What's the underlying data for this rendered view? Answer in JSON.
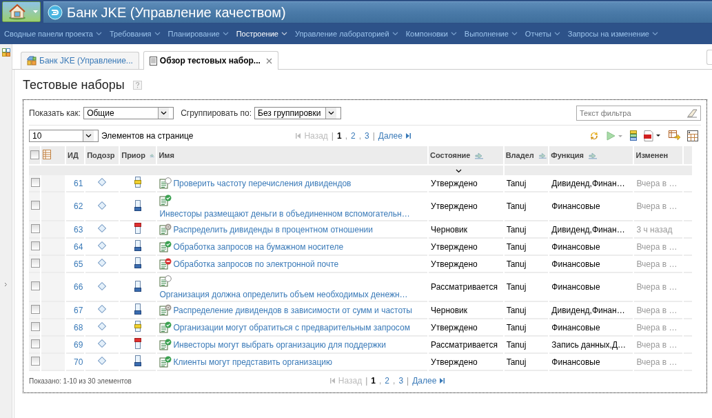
{
  "app_title": "Банк JKE (Управление качеством)",
  "nav": [
    {
      "label": "Сводные панели проекта",
      "selected": false
    },
    {
      "label": "Требования",
      "selected": false
    },
    {
      "label": "Планирование",
      "selected": false
    },
    {
      "label": "Построение",
      "selected": true
    },
    {
      "label": "Управление лабораторией",
      "selected": false
    },
    {
      "label": "Компоновки",
      "selected": false
    },
    {
      "label": "Выполнение",
      "selected": false
    },
    {
      "label": "Отчеты",
      "selected": false
    },
    {
      "label": "Запросы на изменение",
      "selected": false
    }
  ],
  "tabs": [
    {
      "label": "Банк JKE (Управление...",
      "selected": false,
      "closable": false
    },
    {
      "label": "Обзор тестовых набор...",
      "selected": true,
      "closable": true
    }
  ],
  "page_title": "Тестовые наборы",
  "show_as": {
    "label": "Показать как:",
    "value": "Общие"
  },
  "group_by": {
    "label": "Сгруппировать по:",
    "value": "Без группировки"
  },
  "filter": {
    "placeholder": "Текст фильтра"
  },
  "page_size": {
    "value": "10",
    "label": "Элементов на странице"
  },
  "pager_top": [
    {
      "kind": "prev",
      "text": "Назад",
      "disabled": true
    },
    {
      "kind": "sep",
      "text": "|"
    },
    {
      "kind": "page",
      "text": "1",
      "selected": true
    },
    {
      "kind": "sep",
      "text": ","
    },
    {
      "kind": "page",
      "text": "2",
      "selected": false
    },
    {
      "kind": "sep",
      "text": ","
    },
    {
      "kind": "page",
      "text": "3",
      "selected": false
    },
    {
      "kind": "sep",
      "text": "|"
    },
    {
      "kind": "next",
      "text": "Далее",
      "disabled": false
    }
  ],
  "select_all_checked": false,
  "columns": [
    {
      "label": "ИД",
      "sortable": false
    },
    {
      "label": "Подозр",
      "sortable": false
    },
    {
      "label": "Приор",
      "sortable": true
    },
    {
      "label": "Имя",
      "sortable": false
    },
    {
      "label": "Состояние",
      "sortable": true
    },
    {
      "label": "Владел",
      "sortable": true
    },
    {
      "label": "Функция",
      "sortable": true
    },
    {
      "label": "Изменен",
      "sortable": false
    }
  ],
  "rows": [
    {
      "id": "61",
      "checked": false,
      "priority": {
        "kind": "medium"
      },
      "status_icon": {
        "kind": "review"
      },
      "name": "Проверить частоту перечисления дивидендов",
      "wrapped": false,
      "state": "Утверждено",
      "owner": "Tanuj",
      "function": "Дивиденд,Финан…",
      "modified": "Вчера в …"
    },
    {
      "id": "62",
      "checked": false,
      "priority": {
        "kind": "low"
      },
      "status_icon": {
        "kind": "approved"
      },
      "name": "Инвесторы размещают деньги в объединенном вспомогательн…",
      "wrapped": true,
      "state": "Утверждено",
      "owner": "Tanuj",
      "function": "Финансовые",
      "modified": "Вчера в …"
    },
    {
      "id": "63",
      "checked": false,
      "priority": {
        "kind": "high"
      },
      "status_icon": {
        "kind": "draft"
      },
      "name": "Распределить дивиденды в процентном отношении",
      "wrapped": false,
      "state": "Черновик",
      "owner": "Tanuj",
      "function": "Дивиденд,Финан…",
      "modified": "3 ч назад"
    },
    {
      "id": "64",
      "checked": false,
      "priority": {
        "kind": "low"
      },
      "status_icon": {
        "kind": "approved"
      },
      "name": "Обработка запросов на бумажном носителе",
      "wrapped": false,
      "state": "Утверждено",
      "owner": "Tanuj",
      "function": "Финансовые",
      "modified": "Вчера в …"
    },
    {
      "id": "65",
      "checked": false,
      "priority": {
        "kind": "low"
      },
      "status_icon": {
        "kind": "rejected"
      },
      "name": "Обработка запросов по электронной почте",
      "wrapped": false,
      "state": "Утверждено",
      "owner": "Tanuj",
      "function": "Финансовые",
      "modified": "Вчера в …"
    },
    {
      "id": "66",
      "checked": false,
      "priority": {
        "kind": "low"
      },
      "status_icon": {
        "kind": "review"
      },
      "name": "Организация должна определить объем необходимых денежн…",
      "wrapped": true,
      "state": "Рассматривается",
      "owner": "Tanuj",
      "function": "Финансовые",
      "modified": "Вчера в …"
    },
    {
      "id": "67",
      "checked": false,
      "priority": {
        "kind": "low"
      },
      "status_icon": {
        "kind": "draft"
      },
      "name": "Распределение дивидендов в зависимости от сумм и частоты",
      "wrapped": false,
      "state": "Черновик",
      "owner": "Tanuj",
      "function": "Дивиденд,Финан…",
      "modified": "Вчера в …"
    },
    {
      "id": "68",
      "checked": false,
      "priority": {
        "kind": "medium"
      },
      "status_icon": {
        "kind": "approved"
      },
      "name": "Организации могут обратиться с предварительным запросом",
      "wrapped": false,
      "state": "Утверждено",
      "owner": "Tanuj",
      "function": "Финансовые",
      "modified": "Вчера в …"
    },
    {
      "id": "69",
      "checked": false,
      "priority": {
        "kind": "high"
      },
      "status_icon": {
        "kind": "approved"
      },
      "name": "Инвесторы могут выбрать организацию для поддержки",
      "wrapped": false,
      "state": "Рассматривается",
      "owner": "Tanuj",
      "function": "Запись данных,Д…",
      "modified": "Вчера в …"
    },
    {
      "id": "70",
      "checked": false,
      "priority": {
        "kind": "low"
      },
      "status_icon": {
        "kind": "approved"
      },
      "name": "Клиенты могут представить организацию",
      "wrapped": false,
      "state": "Утверждено",
      "owner": "Tanuj",
      "function": "Финансовые",
      "modified": "Вчера в …"
    }
  ],
  "summary": "Показано: 1-10 из 30 элементов",
  "pager_bottom": [
    {
      "kind": "prev",
      "text": "Назад",
      "disabled": true
    },
    {
      "kind": "sep",
      "text": "|"
    },
    {
      "kind": "page",
      "text": "1",
      "selected": true
    },
    {
      "kind": "sep",
      "text": ","
    },
    {
      "kind": "page",
      "text": "2",
      "selected": false
    },
    {
      "kind": "sep",
      "text": ","
    },
    {
      "kind": "page",
      "text": "3",
      "selected": false
    },
    {
      "kind": "sep",
      "text": "|"
    },
    {
      "kind": "next",
      "text": "Далее",
      "disabled": false
    }
  ]
}
